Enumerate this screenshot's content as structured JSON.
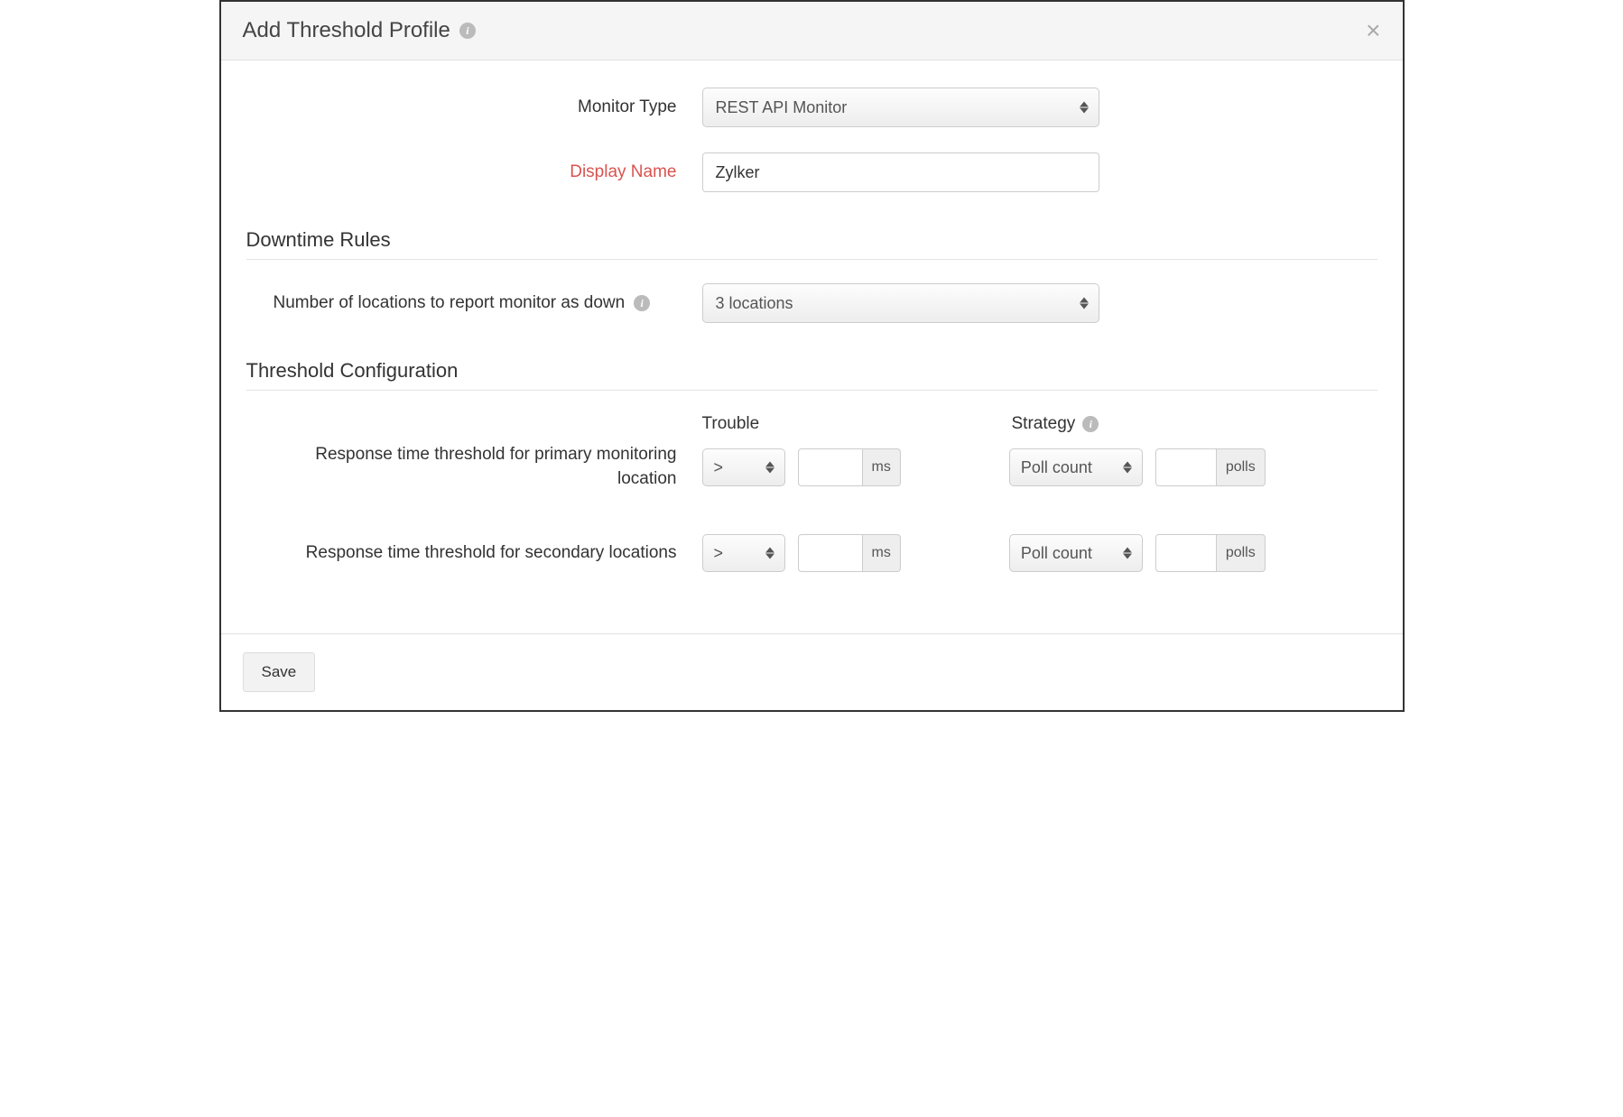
{
  "header": {
    "title": "Add Threshold Profile"
  },
  "form": {
    "monitorType": {
      "label": "Monitor Type",
      "value": "REST API Monitor"
    },
    "displayName": {
      "label": "Display Name",
      "value": "Zylker"
    }
  },
  "downtime": {
    "sectionTitle": "Downtime Rules",
    "locationsLabel": "Number of locations to report monitor as down",
    "locationsValue": "3 locations"
  },
  "threshold": {
    "sectionTitle": "Threshold Configuration",
    "troubleHeader": "Trouble",
    "strategyHeader": "Strategy",
    "rows": [
      {
        "label": "Response time threshold for primary monitoring location",
        "operator": ">",
        "value": "",
        "unit": "ms",
        "strategy": "Poll count",
        "strategyValue": "",
        "strategyUnit": "polls"
      },
      {
        "label": "Response time threshold for secondary locations",
        "operator": ">",
        "value": "",
        "unit": "ms",
        "strategy": "Poll count",
        "strategyValue": "",
        "strategyUnit": "polls"
      }
    ]
  },
  "footer": {
    "saveLabel": "Save"
  }
}
